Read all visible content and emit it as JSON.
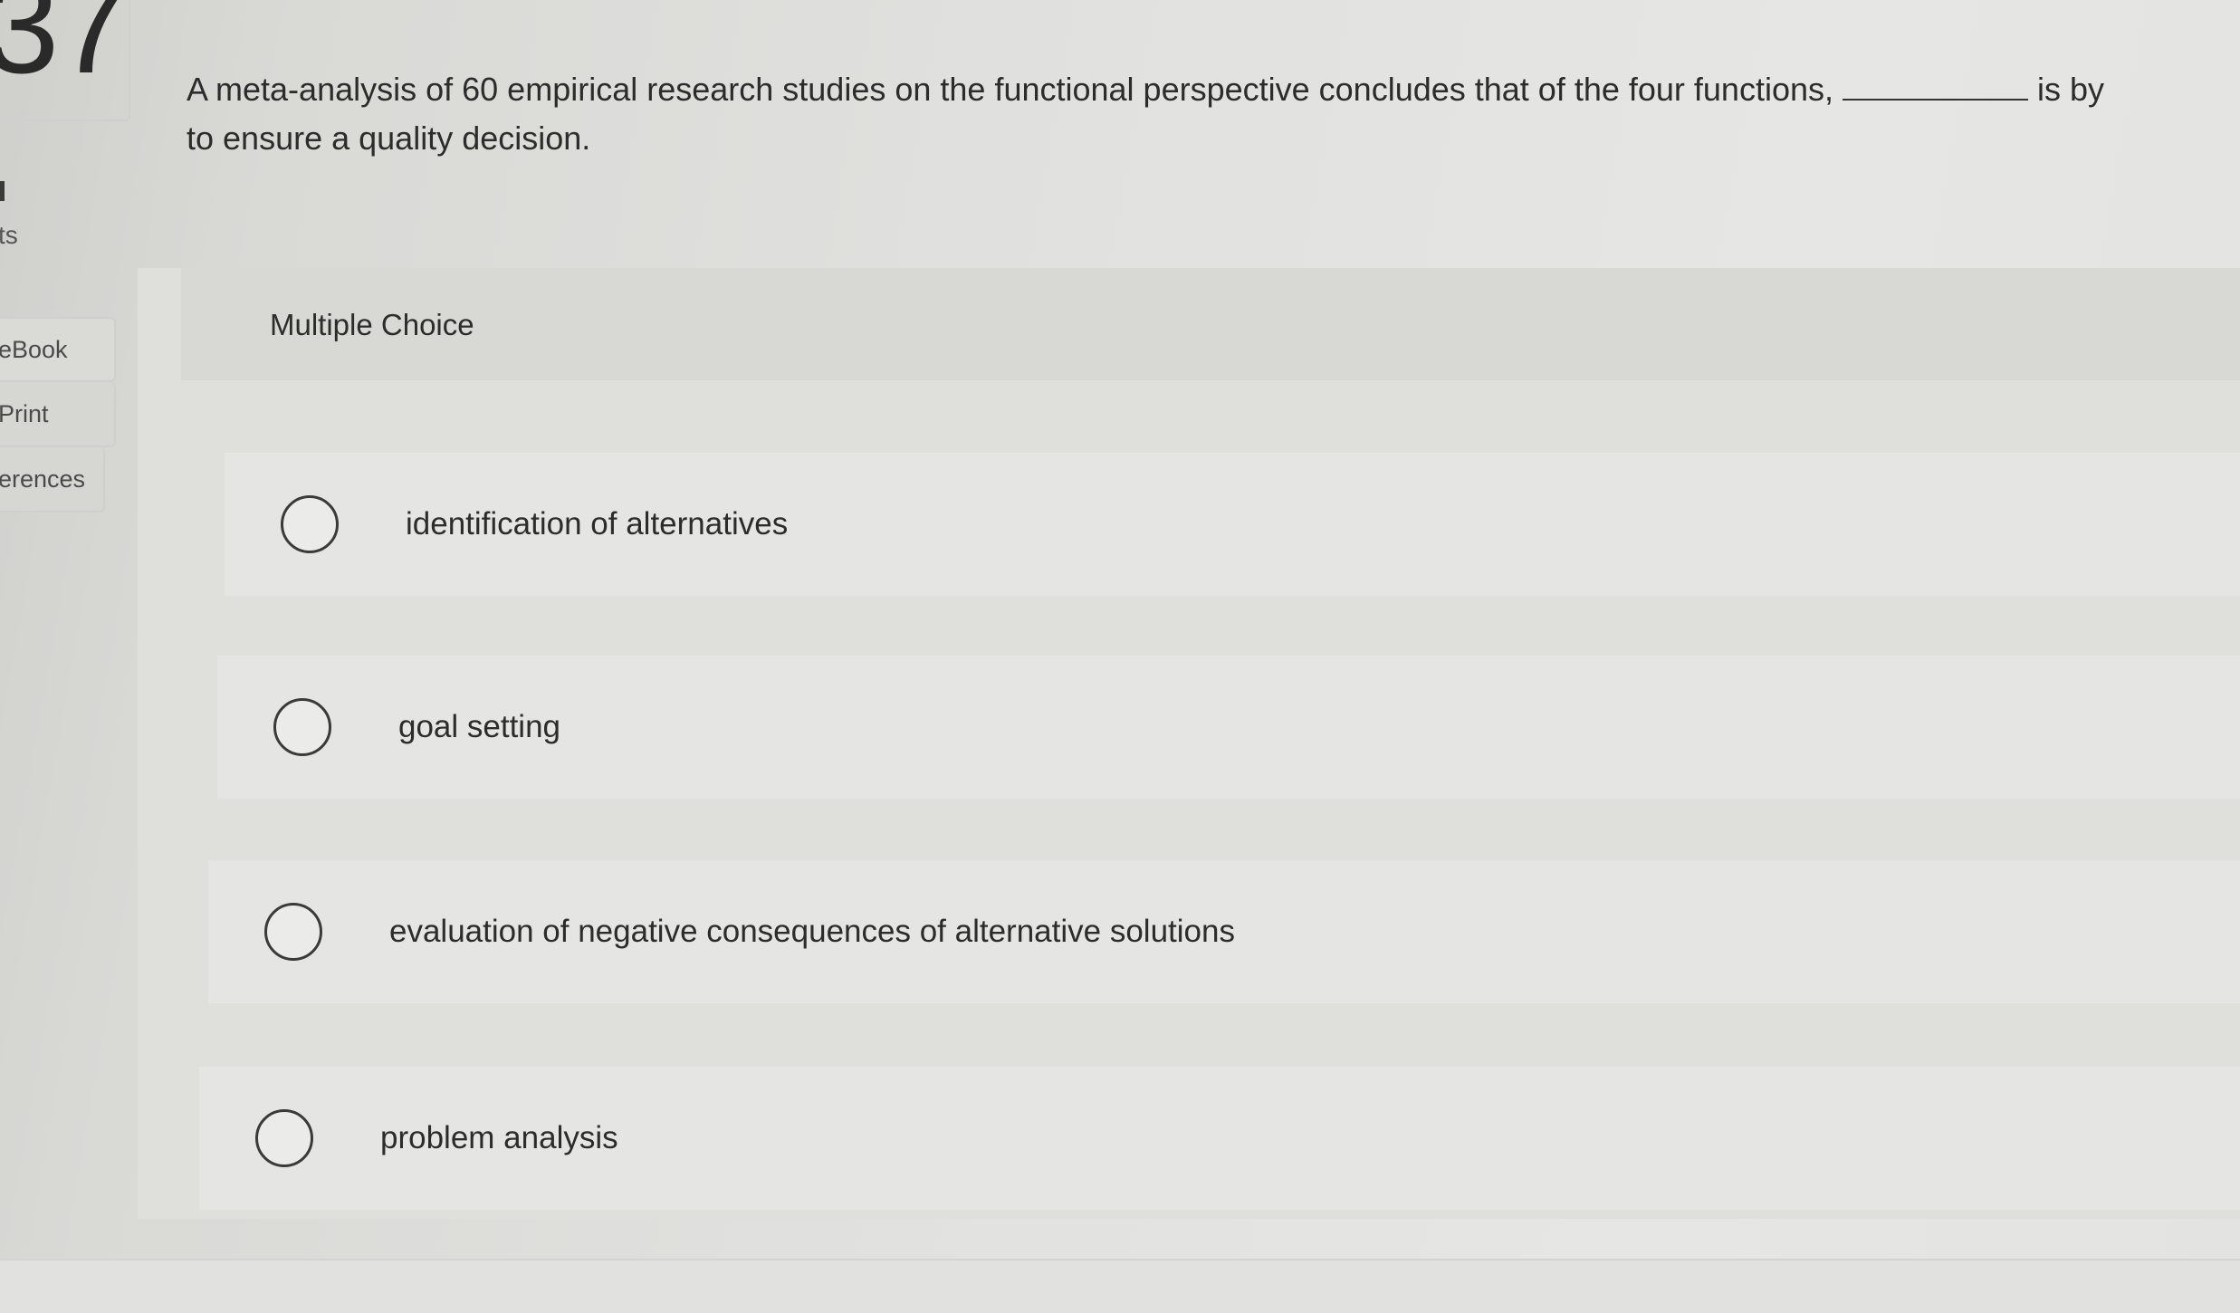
{
  "question_number": "37",
  "sidebar": {
    "points_label": "ts",
    "tools": [
      {
        "label": "eBook"
      },
      {
        "label": "Print"
      },
      {
        "label": "erences"
      }
    ]
  },
  "question": {
    "text_before": "A meta-analysis of 60 empirical research studies on the functional perspective concludes that of the four functions,",
    "text_after": "is by",
    "text_line2": "to ensure a quality decision."
  },
  "answer_block": {
    "type_label": "Multiple Choice",
    "options": [
      {
        "label": "identification of alternatives"
      },
      {
        "label": "goal setting"
      },
      {
        "label": "evaluation of negative consequences of alternative solutions"
      },
      {
        "label": "problem analysis"
      }
    ]
  }
}
